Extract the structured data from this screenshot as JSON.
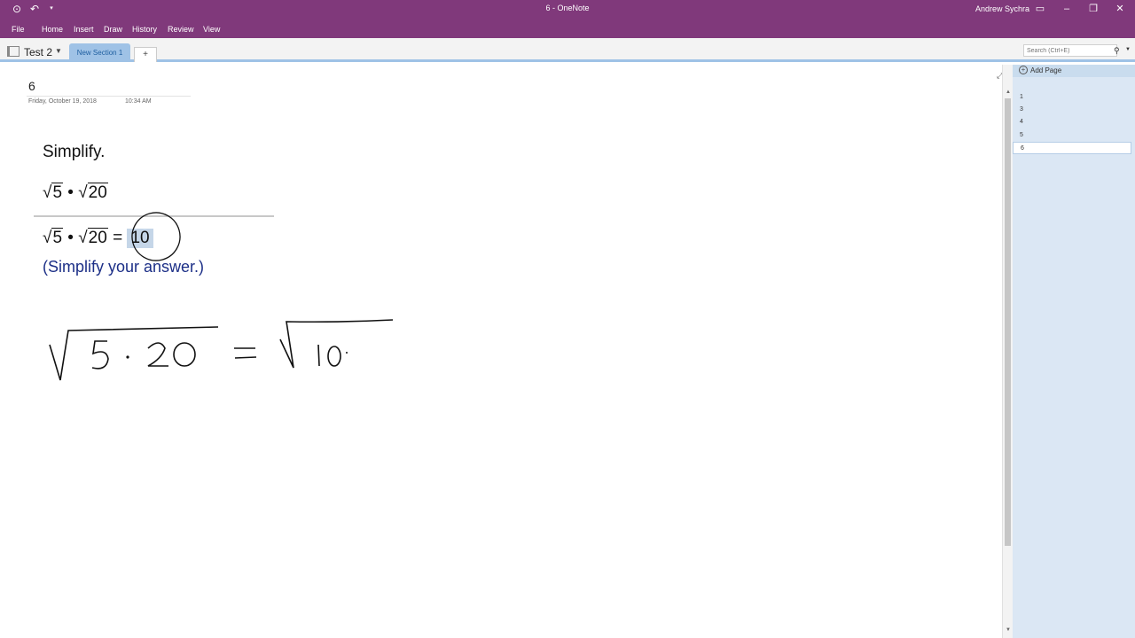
{
  "titlebar": {
    "title": "6  -  OneNote",
    "user": "Andrew Sychra",
    "back_icon": "circle-back-arrow-icon",
    "undo_icon": "undo-icon",
    "quick_access_icon": "customize-quick-access-icon"
  },
  "ribbon": {
    "tabs": [
      "File",
      "Home",
      "Insert",
      "Draw",
      "History",
      "Review",
      "View"
    ]
  },
  "notebook": {
    "name": "Test 2",
    "section_tab": "New Section 1",
    "add_section": "+"
  },
  "search": {
    "placeholder": "Search (Ctrl+E)"
  },
  "page": {
    "title": "6",
    "date": "Friday, October 19, 2018",
    "time": "10:34 AM",
    "problem": {
      "instruction": "Simplify.",
      "radicand_a": "5",
      "radicand_b": "20",
      "operator": "•",
      "equals": "=",
      "answer": "10",
      "hint": "(Simplify your answer.)"
    }
  },
  "pages_pane": {
    "add_page": "Add Page",
    "pages": [
      "1",
      "3",
      "4",
      "5",
      "6"
    ],
    "selected": "6"
  },
  "colors": {
    "brand": "#80397b",
    "section_tab": "#9fc2e6",
    "pages_pane": "#dbe7f4",
    "hint_text": "#1c2f87",
    "answer_highlight": "#c5d6e8"
  }
}
